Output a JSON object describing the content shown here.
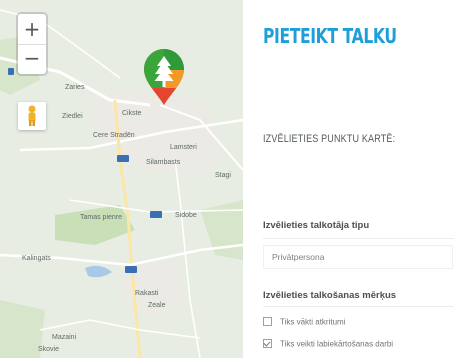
{
  "map": {
    "zoom_in_label": "+",
    "zoom_out_label": "−",
    "labels": {
      "zaries": "Zaries",
      "ziedlei": "Ziedlei",
      "cikste": "Cikste",
      "cere_straden": "Cere Stradēn",
      "lamsteri": "Lamsteri",
      "silambasts": "Silambasts",
      "stagi": "Stagi",
      "tamas_pienre": "Tamas pienre",
      "sidobe": "Sidobe",
      "kalingats": "Kalingats",
      "rakasti": "Rakasti",
      "zeale": "Zeale",
      "mazaini": "Mazaini",
      "skovie": "Skovie"
    },
    "colors": {
      "marker_green": "#3aa53a",
      "marker_red": "#e5452f",
      "marker_orange": "#f29a24",
      "pegman": "#f0b429"
    },
    "icons": [
      "zoom-in-icon",
      "zoom-out-icon",
      "pegman-icon",
      "map-marker-icon"
    ]
  },
  "form": {
    "title": "PIETEIKT TALKU",
    "map_point_heading": "IZVĒLIETIES PUNKTU KARTĒ:",
    "organizer_type": {
      "label": "Izvēlieties talkotāja tipu",
      "value": "Privātpersona"
    },
    "purpose": {
      "label": "Izvēlieties talkošanas mērķus",
      "options": [
        {
          "label": "Tiks vākti atkritumi",
          "checked": false
        },
        {
          "label": "Tiks veikti labiekārtošanas darbi",
          "checked": true
        }
      ]
    },
    "accent_color": "#1e9fd9"
  }
}
